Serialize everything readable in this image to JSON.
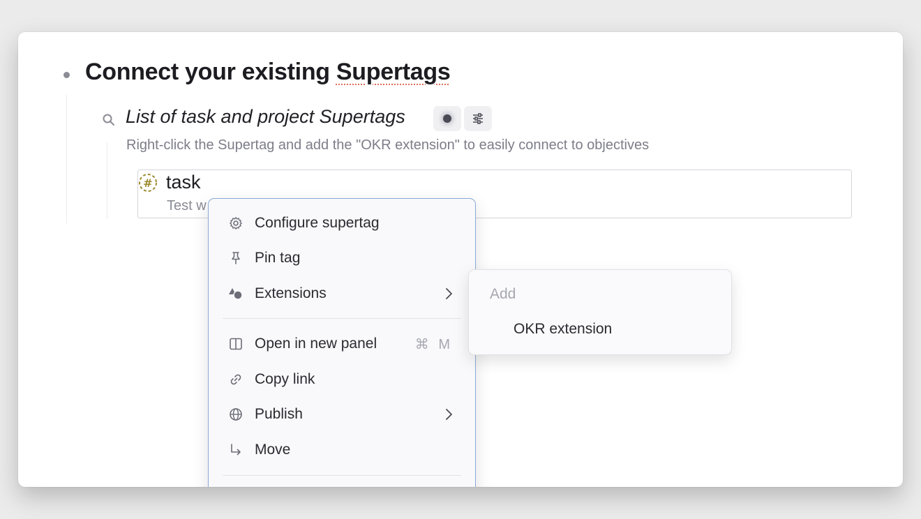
{
  "heading": {
    "title_prefix": "Connect your existing ",
    "title_misspelled": "Supertags"
  },
  "search": {
    "title": "List of task and project Supertags",
    "description": "Right-click the Supertag and add the \"OKR extension\" to easily connect to objectives"
  },
  "result": {
    "name": "task",
    "subtitle": "Test w"
  },
  "context_menu": {
    "items": [
      {
        "label": "Configure supertag",
        "icon": "gear-icon"
      },
      {
        "label": "Pin tag",
        "icon": "pin-icon"
      },
      {
        "label": "Extensions",
        "icon": "shapes-icon",
        "has_submenu": true
      },
      {
        "label": "Open in new panel",
        "icon": "panel-icon",
        "shortcut": "⌘ M"
      },
      {
        "label": "Copy link",
        "icon": "link-icon"
      },
      {
        "label": "Publish",
        "icon": "globe-icon",
        "has_submenu": true
      },
      {
        "label": "Move",
        "icon": "move-arrow-icon"
      }
    ]
  },
  "submenu": {
    "header": "Add",
    "items": [
      {
        "label": "OKR extension"
      }
    ]
  },
  "colors": {
    "accent_border": "#8aa9d6",
    "tag_icon": "#9c8a2e",
    "misspell_underline": "#e06b5a"
  }
}
